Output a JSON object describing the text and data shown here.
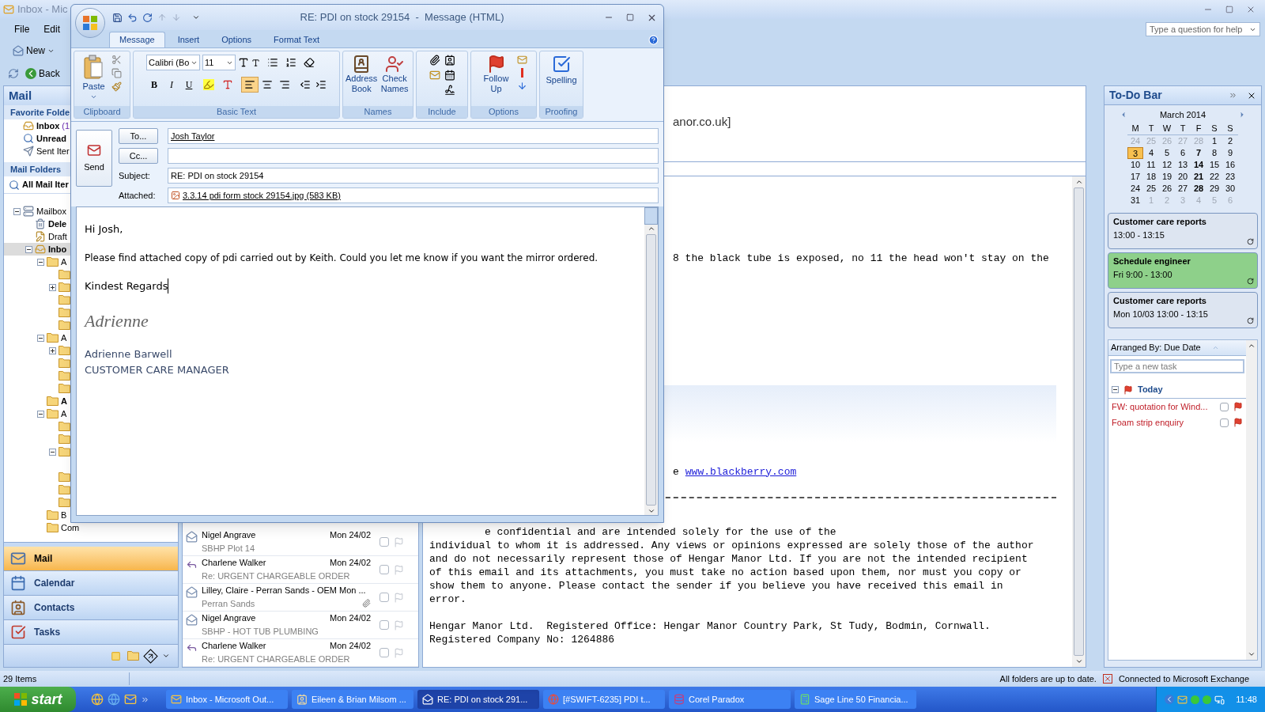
{
  "main_window": {
    "title": "Inbox - Mic",
    "menu": [
      "File",
      "Edit"
    ],
    "new_button": "New",
    "back_button": "Back",
    "help_placeholder": "Type a question for help"
  },
  "nav_pane": {
    "title": "Mail",
    "favorites_header": "Favorite Folde",
    "favorites": [
      {
        "label": "Inbox",
        "count": "(1",
        "bold": true,
        "kind": "inbox"
      },
      {
        "label": "Unread",
        "bold": true,
        "kind": "search"
      },
      {
        "label": "Sent Iter",
        "bold": false,
        "kind": "sent"
      }
    ],
    "folders_header": "Mail Folders",
    "all_items": "All Mail Iter",
    "tree": [
      {
        "label": "Mailbox",
        "kind": "mailbox",
        "bold": false,
        "selected": false,
        "expanded": true,
        "children": [
          {
            "label": "Dele",
            "kind": "trash",
            "bold": true,
            "selected": false
          },
          {
            "label": "Draft",
            "kind": "drafts",
            "bold": false,
            "selected": false
          },
          {
            "label": "Inbo",
            "kind": "inbox",
            "bold": true,
            "selected": true,
            "expanded": true,
            "children": [
              {
                "label": "A",
                "kind": "folder",
                "bold": false,
                "selected": false,
                "expanded": true,
                "children": [
                  {
                    "kind": "folder",
                    "selected": false
                  },
                  {
                    "kind": "folder",
                    "selected": false,
                    "expanded": false
                  },
                  {
                    "kind": "folder",
                    "selected": false
                  },
                  {
                    "kind": "folder",
                    "selected": false
                  },
                  {
                    "kind": "folder",
                    "selected": false
                  }
                ]
              },
              {
                "label": "A",
                "kind": "folder",
                "bold": false,
                "selected": false,
                "expanded": true,
                "children": [
                  {
                    "kind": "folder",
                    "selected": false,
                    "expanded": false
                  },
                  {
                    "kind": "folder",
                    "selected": false
                  },
                  {
                    "kind": "folder",
                    "selected": false
                  },
                  {
                    "kind": "folder",
                    "selected": false
                  }
                ]
              },
              {
                "label": "A",
                "kind": "folder",
                "bold": true,
                "selected": false
              },
              {
                "label": "A",
                "kind": "folder",
                "bold": false,
                "selected": false,
                "expanded": true,
                "children": [
                  {
                    "kind": "folder",
                    "selected": false
                  },
                  {
                    "kind": "folder",
                    "selected": false
                  },
                  {
                    "kind": "folder",
                    "selected": false,
                    "expanded": true
                  },
                  {
                    "kind": "folder",
                    "selected": false
                  },
                  {
                    "kind": "folder",
                    "selected": false
                  },
                  {
                    "kind": "folder",
                    "selected": false
                  }
                ]
              },
              {
                "label": "B",
                "kind": "folder",
                "bold": false,
                "selected": false
              },
              {
                "label": "Com",
                "kind": "folder",
                "bold": false,
                "selected": false
              }
            ]
          }
        ]
      }
    ],
    "buttons": [
      {
        "label": "Mail",
        "kind": "mail",
        "selected": true
      },
      {
        "label": "Calendar",
        "kind": "calendar",
        "selected": false
      },
      {
        "label": "Contacts",
        "kind": "contacts",
        "selected": false
      },
      {
        "label": "Tasks",
        "kind": "tasks",
        "selected": false
      }
    ]
  },
  "message_list": [
    {
      "sender": "Nigel Angrave",
      "date": "Mon 24/02",
      "subject": "SBHP Plot 14",
      "kind": "read",
      "attachment": false,
      "checked": false
    },
    {
      "sender": "Charlene Walker",
      "date": "Mon 24/02",
      "subject": "Re: URGENT CHARGEABLE ORDER",
      "kind": "replied",
      "attachment": false,
      "checked": false
    },
    {
      "sender": "Lilley, Claire - Perran Sands - OEM Mon ...",
      "subject": "Perran Sands",
      "kind": "read",
      "attachment": true,
      "checked": false
    },
    {
      "sender": "Nigel Angrave",
      "date": "Mon 24/02",
      "subject": "SBHP - HOT TUB PLUMBING",
      "kind": "read",
      "attachment": false,
      "checked": false
    },
    {
      "sender": "Charlene Walker",
      "date": "Mon 24/02",
      "subject": "Re: URGENT CHARGEABLE ORDER",
      "kind": "replied",
      "attachment": false,
      "checked": false
    }
  ],
  "reading_pane": {
    "header_fragment": "anor.co.uk]",
    "body_fragment": "8 the black tube is exposed, no 11 the head won't stay on the",
    "link_prefix": "e",
    "link": "www.blackberry.com",
    "disclaimer": [
      "e confidential and are intended solely for the use of the",
      "individual to whom it is addressed. Any views or opinions expressed are solely those of the author",
      "and do not necessarily represent those of Hengar Manor Ltd. If you are not the intended recipient",
      "of this email and its attachments, you must take no action based upon them, nor must you copy or",
      "show them to anyone. Please contact the sender if you believe you have received this email in",
      "error."
    ],
    "footer": [
      "Hengar Manor Ltd.  Registered Office: Hengar Manor Country Park, St Tudy, Bodmin, Cornwall.",
      "Registered Company No: 1264886"
    ]
  },
  "todo_bar": {
    "title": "To-Do Bar",
    "month": "March 2014",
    "weekdays": [
      "M",
      "T",
      "W",
      "T",
      "F",
      "S",
      "S"
    ],
    "days": [
      {
        "label": "24",
        "kind": "other",
        "selected": false
      },
      {
        "label": "25",
        "kind": "other",
        "selected": false
      },
      {
        "label": "26",
        "kind": "other",
        "selected": false
      },
      {
        "label": "27",
        "kind": "other",
        "selected": false
      },
      {
        "label": "28",
        "kind": "other",
        "selected": false
      },
      {
        "label": "1",
        "kind": "normal",
        "selected": false
      },
      {
        "label": "2",
        "kind": "normal",
        "selected": false
      },
      {
        "label": "3",
        "kind": "normal",
        "selected": true
      },
      {
        "label": "4",
        "kind": "normal",
        "selected": false
      },
      {
        "label": "5",
        "kind": "normal",
        "selected": false
      },
      {
        "label": "6",
        "kind": "normal",
        "selected": false
      },
      {
        "label": "7",
        "kind": "busy",
        "selected": false
      },
      {
        "label": "8",
        "kind": "normal",
        "selected": false
      },
      {
        "label": "9",
        "kind": "normal",
        "selected": false
      },
      {
        "label": "10",
        "kind": "normal",
        "selected": false
      },
      {
        "label": "11",
        "kind": "normal",
        "selected": false
      },
      {
        "label": "12",
        "kind": "normal",
        "selected": false
      },
      {
        "label": "13",
        "kind": "normal",
        "selected": false
      },
      {
        "label": "14",
        "kind": "busy",
        "selected": false
      },
      {
        "label": "15",
        "kind": "normal",
        "selected": false
      },
      {
        "label": "16",
        "kind": "normal",
        "selected": false
      },
      {
        "label": "17",
        "kind": "normal",
        "selected": false
      },
      {
        "label": "18",
        "kind": "normal",
        "selected": false
      },
      {
        "label": "19",
        "kind": "normal",
        "selected": false
      },
      {
        "label": "20",
        "kind": "normal",
        "selected": false
      },
      {
        "label": "21",
        "kind": "busy",
        "selected": false
      },
      {
        "label": "22",
        "kind": "normal",
        "selected": false
      },
      {
        "label": "23",
        "kind": "normal",
        "selected": false
      },
      {
        "label": "24",
        "kind": "normal",
        "selected": false
      },
      {
        "label": "25",
        "kind": "normal",
        "selected": false
      },
      {
        "label": "26",
        "kind": "normal",
        "selected": false
      },
      {
        "label": "27",
        "kind": "normal",
        "selected": false
      },
      {
        "label": "28",
        "kind": "busy",
        "selected": false
      },
      {
        "label": "29",
        "kind": "normal",
        "selected": false
      },
      {
        "label": "30",
        "kind": "normal",
        "selected": false
      },
      {
        "label": "31",
        "kind": "normal",
        "selected": false
      },
      {
        "label": "1",
        "kind": "other",
        "selected": false
      },
      {
        "label": "2",
        "kind": "other",
        "selected": false
      },
      {
        "label": "3",
        "kind": "other",
        "selected": false
      },
      {
        "label": "4",
        "kind": "other",
        "selected": false
      },
      {
        "label": "5",
        "kind": "other",
        "selected": false
      },
      {
        "label": "6",
        "kind": "other",
        "selected": false
      }
    ],
    "appointments": [
      {
        "title": "Customer care reports",
        "time": "13:00 - 13:15",
        "color": "#dde5f1"
      },
      {
        "title": "Schedule engineer",
        "time": "Fri 9:00 - 13:00",
        "color": "#8ed08a"
      },
      {
        "title": "Customer care reports",
        "time": "Mon 10/03 13:00 - 13:15",
        "color": "#dde5f1"
      }
    ],
    "arranged_by": "Arranged By: Due Date",
    "task_placeholder": "Type a new task",
    "group": {
      "label": "Today",
      "expanded": true
    },
    "tasks": [
      {
        "title": "FW: quotation for Wind...",
        "checked": false
      },
      {
        "title": "Foam strip enquiry",
        "checked": false
      }
    ]
  },
  "status_bar": {
    "items": "29 Items",
    "sync": "All folders are up to date.",
    "connection": "Connected to Microsoft Exchange"
  },
  "taskbar": {
    "start": "start",
    "windows": [
      {
        "label": "Inbox - Microsoft Out...",
        "kind": "outlook",
        "selected": false
      },
      {
        "label": "Eileen & Brian Milsom ...",
        "kind": "contact",
        "selected": false
      },
      {
        "label": "RE: PDI on stock 291...",
        "kind": "message",
        "selected": true
      },
      {
        "label": "[#SWIFT-6235] PDI t...",
        "kind": "browser",
        "selected": false
      },
      {
        "label": "Corel Paradox",
        "kind": "database",
        "selected": false
      },
      {
        "label": "Sage Line 50 Financia...",
        "kind": "accounts",
        "selected": false
      }
    ],
    "clock": "11:48"
  },
  "compose": {
    "title": "RE: PDI on stock 29154  -  Message (HTML)",
    "tabs": [
      {
        "label": "Message",
        "selected": true
      },
      {
        "label": "Insert",
        "selected": false
      },
      {
        "label": "Options",
        "selected": false
      },
      {
        "label": "Format Text",
        "selected": false
      }
    ],
    "paste": "Paste",
    "font": "Calibri (Bo",
    "size": "11",
    "bold": "B",
    "italic": "I",
    "underline": "U",
    "align_buttons": [
      {
        "kind": "left",
        "selected": true
      },
      {
        "kind": "center",
        "selected": false
      },
      {
        "kind": "right",
        "selected": false
      }
    ],
    "address_book": "Address Book",
    "check_names": "Check Names",
    "follow_up": "Follow Up",
    "spelling": "Spelling",
    "groups": [
      "Clipboard",
      "Basic Text",
      "Names",
      "Include",
      "Options",
      "Proofing"
    ],
    "send": "Send",
    "to_button": "To...",
    "cc_button": "Cc...",
    "to": "Josh Taylor",
    "subject_label": "Subject:",
    "subject": "RE: PDI on stock 29154",
    "attached_label": "Attached:",
    "attachment": "3.3.14 pdi form stock 29154.jpg (583 KB)",
    "body": [
      "Hi Josh,",
      "Please find attached copy of pdi carried out by Keith.  Could you let me know if you want the mirror ordered.",
      "Kindest Regards"
    ],
    "signature": "Adrienne",
    "name": "Adrienne Barwell",
    "role": "CUSTOMER CARE MANAGER"
  }
}
